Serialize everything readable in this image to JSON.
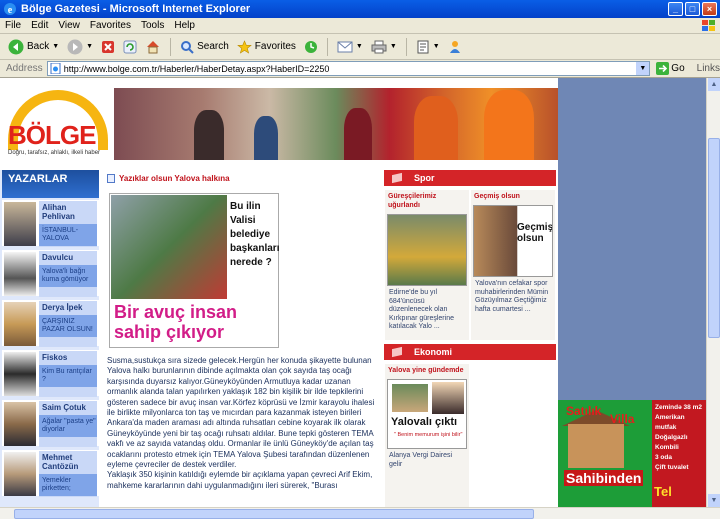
{
  "window": {
    "title": "Bölge Gazetesi - Microsoft Internet Explorer",
    "controls": [
      "_",
      "□",
      "×"
    ]
  },
  "menu": [
    "File",
    "Edit",
    "View",
    "Favorites",
    "Tools",
    "Help"
  ],
  "toolbar": {
    "back_label": "Back",
    "search_label": "Search",
    "favorites_label": "Favorites"
  },
  "address": {
    "label": "Address",
    "url": "http://www.bolge.com.tr/Haberler/HaberDetay.aspx?HaberID=2250",
    "go_label": "Go",
    "links_label": "Links"
  },
  "site": {
    "logo_name": "BÖLGE",
    "logo_tagline": "Doğru, tarafsız, ahlaklı, ilkeli haber"
  },
  "writers": {
    "header": "YAZARLAR",
    "items": [
      {
        "name": "Alihan Pehlivan",
        "title": "İSTANBUL-YALOVA"
      },
      {
        "name": "Davulcu",
        "title": "Yalova'lı bağrı kuma gömüyor"
      },
      {
        "name": "Derya İpek",
        "title": "ÇARŞINIZ PAZAR OLSUN!"
      },
      {
        "name": "Fiskos",
        "title": "Kim Bu rantçılar ?"
      },
      {
        "name": "Saim Çotuk",
        "title": "Ağalar \"pasta ye\" diyorlar"
      },
      {
        "name": "Mehmet Cantözün",
        "title": "Yemekler pirketten;"
      }
    ]
  },
  "article": {
    "headline": "Yazıklar olsun Yalova halkına",
    "photo_side_text": "Bu ilin Valisi belediye başkanları nerede ?",
    "photo_caption": "Bir avuç insan sahip çıkıyor",
    "body": "Susma,sustukça sıra sizede gelecek.Hergün her konuda şikayette bulunan Yalova halkı burunlarının dibinde açılmakta olan çok sayıda taş ocağı karşısında duyarsız kalıyor.Güneyköyünden Armutluya kadar uzanan ormanlık alanda talan yapılırken yaklaşık 182 bin kişilik bir ilde tepkilerini gösteren sadece bir avuç insan var.Körfez köprüsü ve İzmir karayolu ihalesi ile birlikte milyonlarca ton taş ve mıcırdan para kazanmak isteyen birileri Ankara'da maden araması adı altında ruhsatları cebine koyarak ilk olarak Güneyköyünde yeni bir taş ocağı ruhsatı aldılar. Bune tepki gösteren TEMA vakfı ve az sayıda vatandaş oldu. Ormanlar ile ünlü Güneyköy'de açılan taş ocaklarını protesto etmek için TEMA Yalova Şubesi tarafından düzenlenen eyleme çevreciler de destek verdiler.\nYaklaşık 350 kişinin katıldığı eylemde bir açıklama yapan çevreci Arif Ekim, mahkeme kararlarının dahi uygulanmadığını ileri sürerek, \"Burası"
  },
  "sport": {
    "header": "Spor",
    "left": {
      "title": "Güreşçilerimiz uğurlandı",
      "text": "Edirne'de bu yıl 684'üncüsü düzenlenecek olan Kırkpınar güreşlerine katılacak Yalo ..."
    },
    "right": {
      "title": "Geçmiş olsun",
      "img_text": "Geçmiş olsun",
      "text": "Yalova'nın cefakar spor muhabirlerinden Mümin Gözüyılmaz Geçtiğimiz hafta cumartesi ..."
    }
  },
  "economy": {
    "header": "Ekonomi",
    "left": {
      "title": "Yalova yine gündemde",
      "img_text": "Yalovalı çıktı",
      "img_sub": "\" Benim memurum işini bilir\"",
      "text": "Alanya Vergi Dairesi gelir"
    }
  },
  "ad": {
    "title1": "Satılık",
    "title2": "Villa",
    "seller": "Sahibinden",
    "details": [
      "Zemində 38 m2",
      "Amerikan mutfak",
      "Doğalgazlı Kombili",
      "3 oda",
      "Çift tuvalet"
    ],
    "phone": "Tel"
  },
  "colors": {
    "accent_red": "#d42428",
    "nav_blue": "#1d4f9e",
    "xp_blue": "#0a5ee6",
    "page_bg": "#6f87b5"
  }
}
